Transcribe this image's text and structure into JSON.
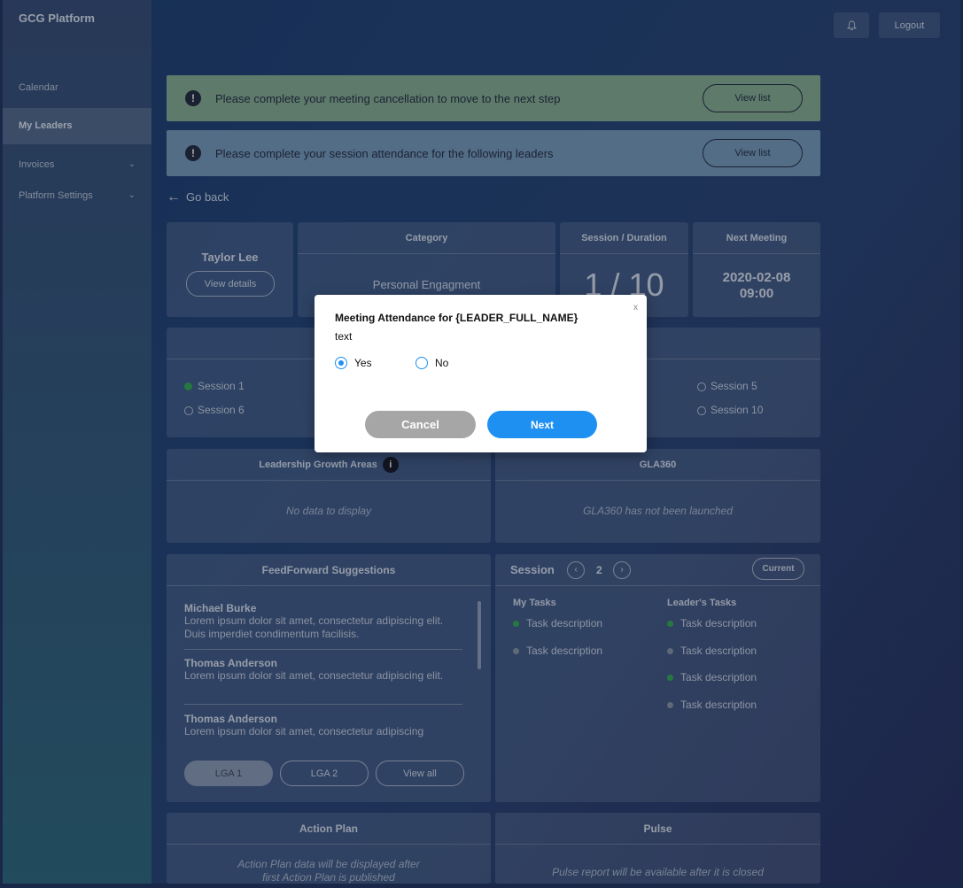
{
  "app": {
    "brand": "GCG Platform"
  },
  "sidebar": {
    "items": [
      {
        "label": "Calendar"
      },
      {
        "label": "My Leaders"
      },
      {
        "label": "Invoices"
      },
      {
        "label": "Platform Settings"
      }
    ]
  },
  "topbar": {
    "bell_icon": "bell-icon",
    "logout_label": "Logout"
  },
  "banners": [
    {
      "message": "Please complete your meeting cancellation to move to the next step",
      "button": "View list",
      "color": "#8cb48f"
    },
    {
      "message": "Please complete your session attendance for the following leaders",
      "button": "View list",
      "color": "#7a9fbc"
    }
  ],
  "goback": {
    "arrow": "←",
    "label": "Go back"
  },
  "leader": {
    "name": "Taylor Lee",
    "view_details": "View details",
    "category_header": "Category",
    "category_value": "Personal Engagment",
    "session_header": "Session / Duration",
    "session_value": "1 / 10",
    "next_meeting_header": "Next Meeting",
    "next_meeting_date": "2020-02-08",
    "next_meeting_time": "09:00"
  },
  "sessions": {
    "items": [
      {
        "label": "Session 1",
        "status": "done"
      },
      {
        "label": "Session 5",
        "status": "open"
      },
      {
        "label": "Session 6",
        "status": "open"
      },
      {
        "label": "Session 10",
        "status": "open"
      }
    ]
  },
  "growth": {
    "header": "Leadership Growth Areas",
    "info_icon": "i",
    "empty": "No data to display"
  },
  "gla360": {
    "header": "GLA360",
    "empty": "GLA360 has not been launched"
  },
  "feedforward": {
    "header": "FeedForward Suggestions",
    "items": [
      {
        "name": "Michael Burke",
        "text": "Lorem ipsum dolor sit amet, consectetur adipiscing elit. Duis imperdiet condimentum facilisis."
      },
      {
        "name": "Thomas Anderson",
        "text": "Lorem ipsum dolor sit amet, consectetur adipiscing elit."
      },
      {
        "name": "Thomas Anderson",
        "text": "Lorem ipsum dolor sit amet, consectetur adipiscing"
      }
    ],
    "buttons": [
      "LGA 1",
      "LGA 2",
      "View all"
    ]
  },
  "tasks": {
    "session_label": "Session",
    "session_number": "2",
    "current_label": "Current",
    "my_tasks_header": "My Tasks",
    "leader_tasks_header": "Leader's Tasks",
    "my_tasks": [
      {
        "label": "Task description",
        "status": "done"
      },
      {
        "label": "Task description",
        "status": "pending"
      }
    ],
    "leader_tasks": [
      {
        "label": "Task description",
        "status": "done"
      },
      {
        "label": "Task description",
        "status": "pending"
      },
      {
        "label": "Task description",
        "status": "done"
      },
      {
        "label": "Task description",
        "status": "pending"
      }
    ]
  },
  "action_plan": {
    "header": "Action Plan",
    "text1": "Action Plan data will be displayed after",
    "text2": "first Action Plan is published"
  },
  "pulse": {
    "header": "Pulse",
    "text": "Pulse report will be available after it is closed"
  },
  "modal": {
    "title": "Meeting Attendance for {LEADER_FULL_NAME}",
    "subtitle": "text",
    "close": "x",
    "option_yes": "Yes",
    "option_no": "No",
    "selected": "Yes",
    "cancel": "Cancel",
    "next": "Next"
  },
  "colors": {
    "accent": "#1e90f2",
    "done": "#2fb24a",
    "pending": "#8e98a5"
  }
}
